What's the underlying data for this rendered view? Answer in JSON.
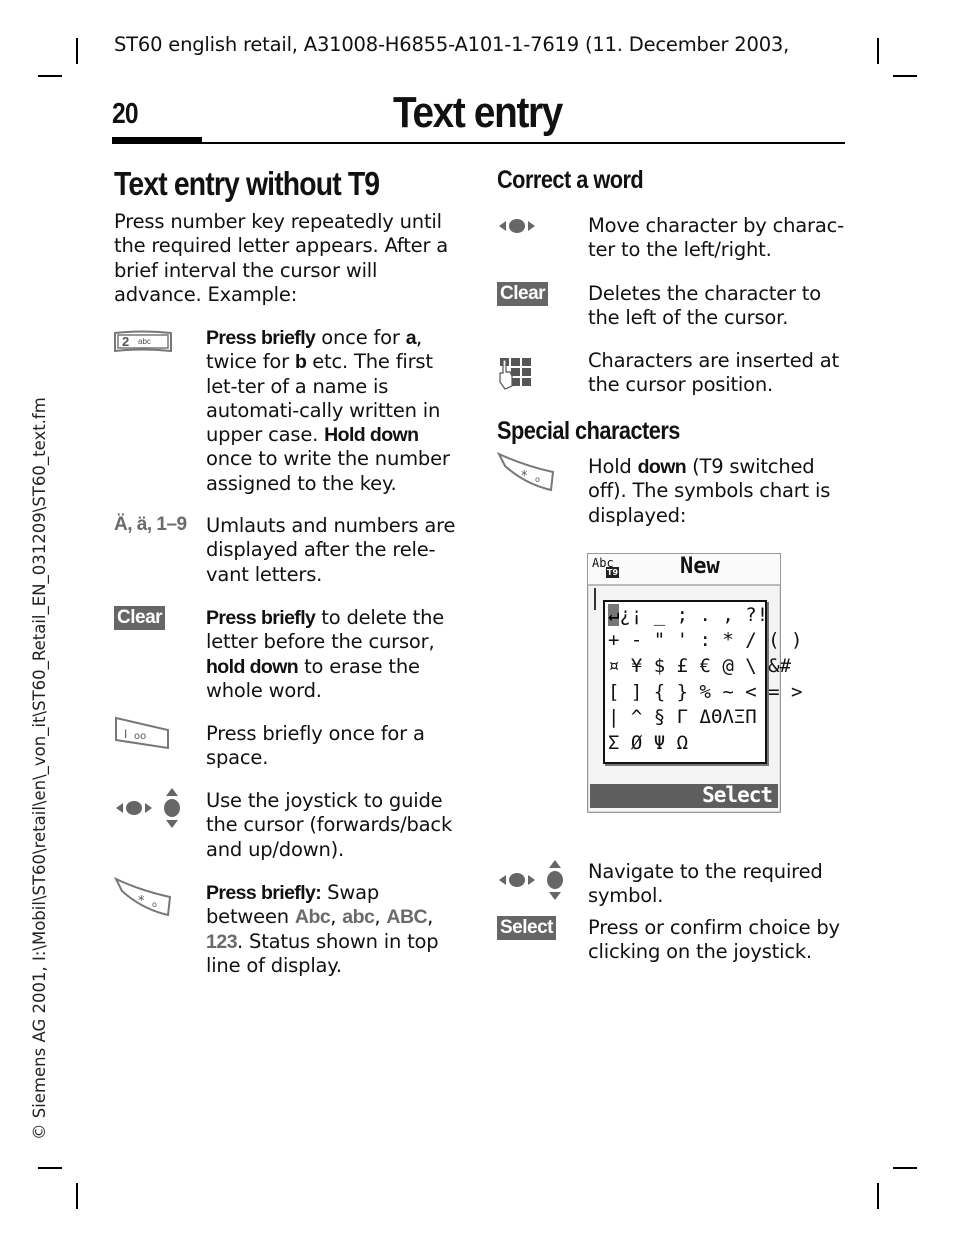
{
  "header": {
    "line": "ST60 english retail, A31008-H6855-A101-1-7619 (11. December 2003,",
    "page_number": "20",
    "chapter_title": "Text entry"
  },
  "sidebar": {
    "file_path": "© Siemens AG 2001, I:\\Mobil\\ST60\\retail\\en\\_von_it\\ST60_Retail_EN_031209\\ST60_text.fm"
  },
  "left": {
    "heading": "Text entry without T9",
    "intro": "Press number key repeatedly until the required letter appears. After a brief interval the cursor will advance. Example:",
    "items": [
      {
        "icon": "key-2-abc-icon",
        "key_text": "2",
        "key_sub": "abc",
        "parts": [
          {
            "b": "Press briefly"
          },
          {
            "t": " once for "
          },
          {
            "b": "a"
          },
          {
            "t": ", twice for "
          },
          {
            "b": "b"
          },
          {
            "t": " etc. The first let-ter of a name is automati-cally written in upper case. "
          },
          {
            "b": "Hold down"
          },
          {
            "t": " once to write the number assigned to the key."
          }
        ]
      },
      {
        "label": "Ä, ä, 1–9",
        "text": "Umlauts and numbers are displayed after the rele-vant letters."
      },
      {
        "softkey": "Clear",
        "parts": [
          {
            "b": "Press briefly"
          },
          {
            "t": " to delete the letter before the cursor, "
          },
          {
            "b": "hold down"
          },
          {
            "t": " to erase the whole word."
          }
        ]
      },
      {
        "icon": "key-1-voicemail-icon",
        "text": "Press briefly once for a space."
      },
      {
        "icon": "joystick-icon",
        "text": "Use the joystick to guide the cursor (forwards/back and up/down)."
      },
      {
        "icon": "key-star-icon",
        "parts": [
          {
            "b": "Press briefly:"
          },
          {
            "t": " Swap between "
          },
          {
            "g": "Abc"
          },
          {
            "t": ", "
          },
          {
            "g": "abc"
          },
          {
            "t": ", "
          },
          {
            "g": "ABC"
          },
          {
            "t": ", "
          },
          {
            "g": "123"
          },
          {
            "t": ". Status shown in top line of display."
          }
        ]
      }
    ]
  },
  "right": {
    "correct_heading": "Correct a word",
    "correct_items": [
      {
        "icon": "joystick-left-right-icon",
        "text": "Move character by charac-ter to the left/right."
      },
      {
        "softkey": "Clear",
        "text": "Deletes the character to the left of the cursor."
      },
      {
        "icon": "keypad-hand-icon",
        "text": "Characters are inserted at the cursor position."
      }
    ],
    "special_heading": "Special characters",
    "special_intro_parts": [
      {
        "t": "Hold "
      },
      {
        "b": "down"
      },
      {
        "t": " (T9 switched off). The symbols chart is displayed:"
      }
    ],
    "screen": {
      "mode": "Abc",
      "t9_badge": "T9",
      "title": "New",
      "symbol_rows": [
        "↵¿¡ _ ; . , ?!",
        "+ - \" ' : * / ( )",
        "¤ ¥ $ £ € @ \\ &#",
        "[ ] { } % ~ < = >",
        "| ^ § Γ ΔΘΛΞΠ",
        "Σ Ø Ψ Ω"
      ],
      "highlighted_symbol": "↵",
      "softkey": "Select"
    },
    "after_items": [
      {
        "icon": "joystick-icon",
        "text": "Navigate to the required symbol."
      },
      {
        "softkey": "Select",
        "text": "Press or confirm choice by clicking on the joystick."
      }
    ]
  }
}
